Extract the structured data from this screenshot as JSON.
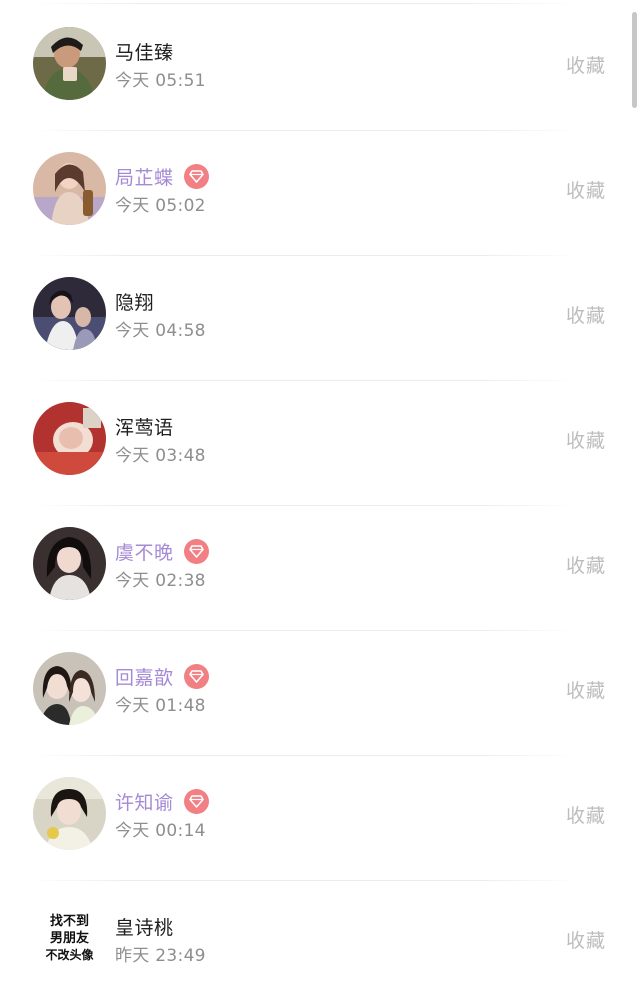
{
  "action_label": "收藏",
  "colors": {
    "vip_name": "#a58ad6",
    "vip_badge": "#f17f83",
    "timestamp": "#8e8e8e",
    "action": "#bdbdbd"
  },
  "items": [
    {
      "name": "马佳臻",
      "time": "今天 05:51",
      "vip": false
    },
    {
      "name": "局芷蝶",
      "time": "今天 05:02",
      "vip": true
    },
    {
      "name": "隐翔",
      "time": "今天 04:58",
      "vip": false
    },
    {
      "name": "浑莺语",
      "time": "今天 03:48",
      "vip": false
    },
    {
      "name": "虞不晚",
      "time": "今天 02:38",
      "vip": true
    },
    {
      "name": "回嘉歆",
      "time": "今天 01:48",
      "vip": true
    },
    {
      "name": "许知谕",
      "time": "今天 00:14",
      "vip": true
    },
    {
      "name": "皇诗桃",
      "time": "昨天 23:49",
      "vip": false,
      "avatar_text": [
        "找不到",
        "男朋友",
        "不改头像"
      ]
    }
  ]
}
